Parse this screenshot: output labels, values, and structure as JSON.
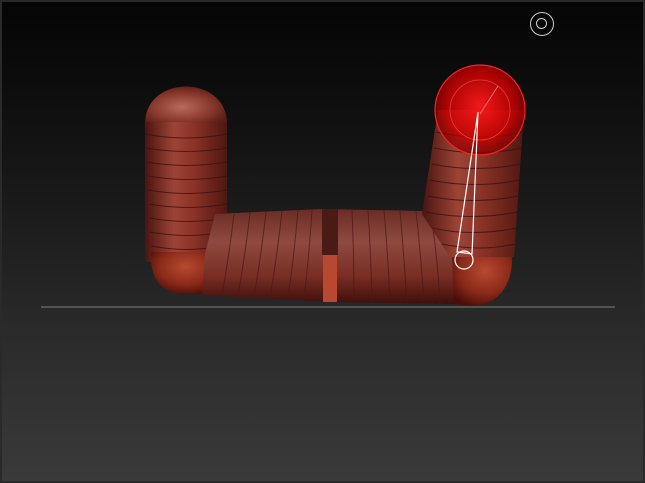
{
  "app": {
    "viewport": "3d-sculpt-canvas"
  },
  "scene": {
    "model": "bent-segmented-tube",
    "material_color": "#8a3226",
    "ground_line_color": "#6f8a6f",
    "gizmo_color": "#d40000",
    "gizmo_line_color": "#ffffff"
  },
  "overlay": {
    "indicator_icon": "target-circle-icon"
  }
}
